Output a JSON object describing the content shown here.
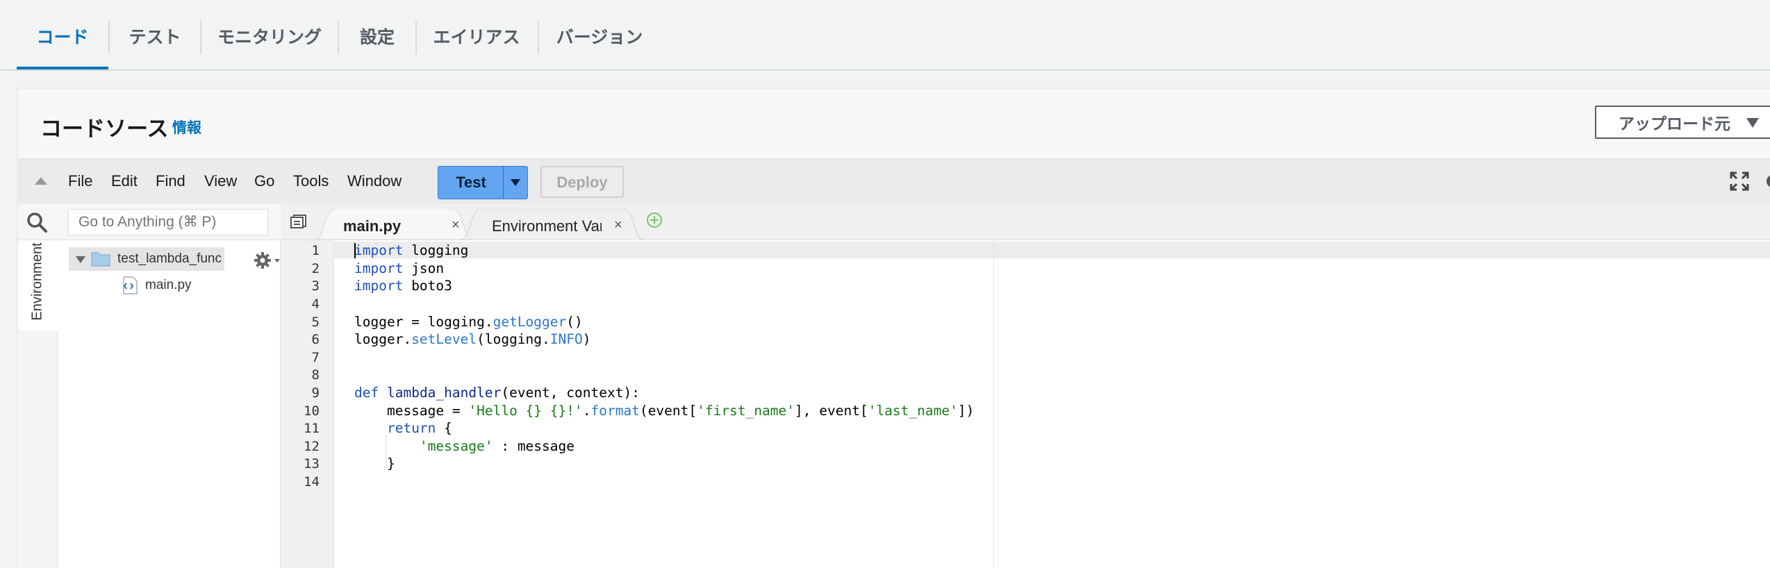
{
  "tabs": [
    {
      "label": "コード",
      "active": true
    },
    {
      "label": "テスト"
    },
    {
      "label": "モニタリング"
    },
    {
      "label": "設定"
    },
    {
      "label": "エイリアス"
    },
    {
      "label": "バージョン"
    }
  ],
  "panel": {
    "title": "コードソース",
    "info_link": "情報",
    "upload_button": "アップロード元"
  },
  "ide": {
    "menu": [
      "File",
      "Edit",
      "Find",
      "View",
      "Go",
      "Tools",
      "Window"
    ],
    "test_button": "Test",
    "deploy_button": "Deploy",
    "search_placeholder": "Go to Anything (⌘ P)",
    "side_tab": "Environment",
    "tree": {
      "folder": "test_lambda_function",
      "files": [
        "main.py"
      ]
    },
    "editor_tabs": [
      {
        "label": "main.py",
        "active": true,
        "close": "×"
      },
      {
        "label": "Environment Vari",
        "close": "×"
      }
    ]
  },
  "code": {
    "line_numbers": [
      "1",
      "2",
      "3",
      "4",
      "5",
      "6",
      "7",
      "8",
      "9",
      "10",
      "11",
      "12",
      "13",
      "14"
    ]
  },
  "colors": {
    "accent": "#0073bb",
    "test_button": "#64a5f2",
    "keyword": "#1e52b8",
    "string": "#1a7a1a"
  }
}
